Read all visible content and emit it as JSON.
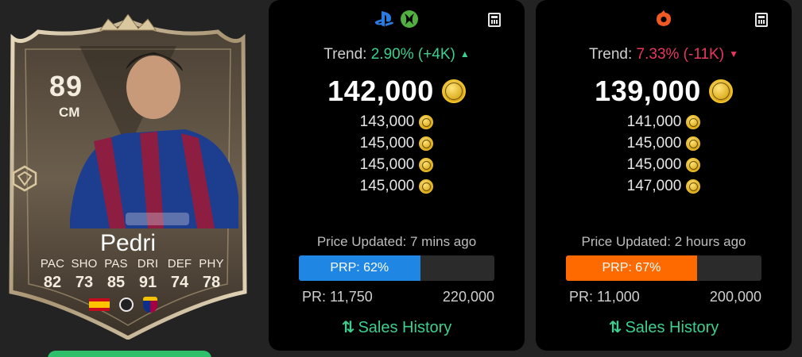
{
  "card": {
    "rating": "89",
    "position": "CM",
    "name": "Pedri",
    "stats": [
      {
        "label": "PAC",
        "value": "82"
      },
      {
        "label": "SHO",
        "value": "73"
      },
      {
        "label": "PAS",
        "value": "85"
      },
      {
        "label": "DRI",
        "value": "91"
      },
      {
        "label": "DEF",
        "value": "74"
      },
      {
        "label": "PHY",
        "value": "78"
      }
    ],
    "icons": [
      "spain-flag-icon",
      "laliga-icon",
      "fc-barcelona-crest-icon",
      "evolution-icon"
    ]
  },
  "panels": [
    {
      "platform_icons": [
        "playstation-icon",
        "xbox-icon"
      ],
      "calculator_icon": "calculator-icon",
      "trend_label": "Trend:",
      "trend_value": "2.90% (+4K)",
      "trend_direction": "up",
      "main_price": "142,000",
      "prices": [
        "143,000",
        "145,000",
        "145,000",
        "145,000"
      ],
      "updated": "Price Updated: 7 mins ago",
      "prp_label": "PRP: 62%",
      "prp_percent": 62,
      "pr_min": "PR: 11,750",
      "pr_max": "220,000",
      "sales_history": "Sales History",
      "accent": "#1f86e4"
    },
    {
      "platform_icons": [
        "origin-pc-icon"
      ],
      "calculator_icon": "calculator-icon",
      "trend_label": "Trend:",
      "trend_value": "7.33% (-11K)",
      "trend_direction": "down",
      "main_price": "139,000",
      "prices": [
        "141,000",
        "145,000",
        "145,000",
        "147,000"
      ],
      "updated": "Price Updated: 2 hours ago",
      "prp_label": "PRP: 67%",
      "prp_percent": 67,
      "pr_min": "PR: 11,000",
      "pr_max": "200,000",
      "sales_history": "Sales History",
      "accent": "#ff6a00"
    }
  ],
  "colors": {
    "trend_up": "#3ecf8e",
    "trend_down": "#e8375f",
    "link": "#3ecf8e",
    "coin": "#f2c230"
  }
}
